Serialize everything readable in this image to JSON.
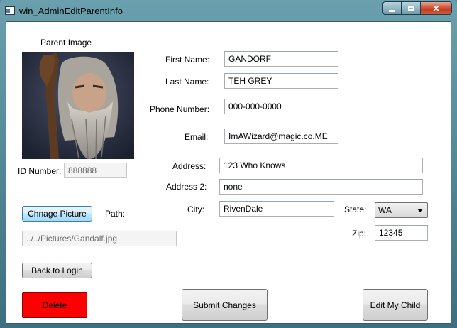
{
  "window": {
    "title": "win_AdminEditParentInfo"
  },
  "photo": {
    "caption": "Parent Image"
  },
  "id_number": {
    "label": "ID Number:",
    "value": "888888"
  },
  "form": {
    "first_name": {
      "label": "First Name:",
      "value": "GANDORF"
    },
    "last_name": {
      "label": "Last Name:",
      "value": "TEH GREY"
    },
    "phone": {
      "label": "Phone Number:",
      "value": "000-000-0000"
    },
    "email": {
      "label": "Email:",
      "value": "ImAWizard@magic.co.ME"
    },
    "address": {
      "label": "Address:",
      "value": "123 Who Knows"
    },
    "address2": {
      "label": "Address 2:",
      "value": "none"
    },
    "city": {
      "label": "City:",
      "value": "RivenDale"
    },
    "state": {
      "label": "State:",
      "value": "WA"
    },
    "zip": {
      "label": "Zip:",
      "value": "12345"
    }
  },
  "picture": {
    "change_label": "Chnage Picture",
    "path_label": "Path:",
    "path_value": "../../Pictures/Gandalf.jpg"
  },
  "buttons": {
    "back": "Back to Login",
    "delete": "Delete",
    "submit": "Submit Changes",
    "edit_child": "Edit My Child"
  },
  "colors": {
    "delete_bg": "#ff0000",
    "focused_button": "#bee6fd"
  }
}
